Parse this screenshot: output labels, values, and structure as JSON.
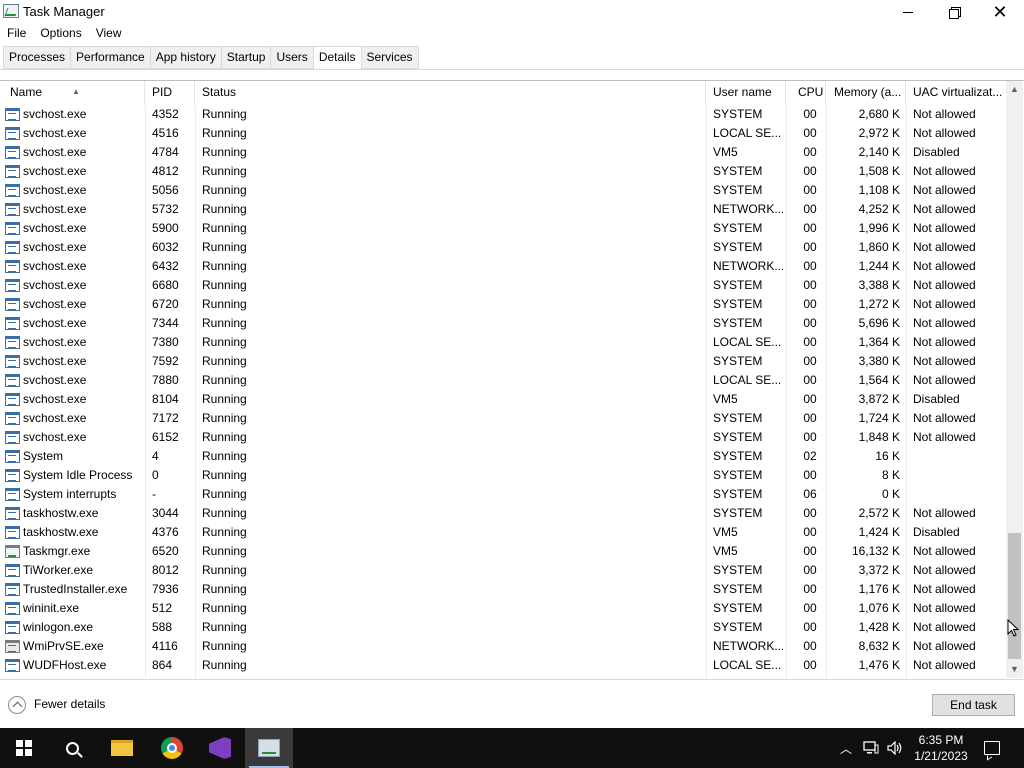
{
  "window": {
    "title": "Task Manager"
  },
  "menu": [
    "File",
    "Options",
    "View"
  ],
  "tabs": [
    "Processes",
    "Performance",
    "App history",
    "Startup",
    "Users",
    "Details",
    "Services"
  ],
  "active_tab": "Details",
  "columns": {
    "name": "Name",
    "pid": "PID",
    "status": "Status",
    "user": "User name",
    "cpu": "CPU",
    "memory": "Memory (a...",
    "uac": "UAC virtualizat..."
  },
  "rows": [
    {
      "name": "svchost.exe",
      "pid": "4352",
      "status": "Running",
      "user": "SYSTEM",
      "cpu": "00",
      "memory": "2,680 K",
      "uac": "Not allowed",
      "icon": "service-icon"
    },
    {
      "name": "svchost.exe",
      "pid": "4516",
      "status": "Running",
      "user": "LOCAL SE...",
      "cpu": "00",
      "memory": "2,972 K",
      "uac": "Not allowed",
      "icon": "service-icon"
    },
    {
      "name": "svchost.exe",
      "pid": "4784",
      "status": "Running",
      "user": "VM5",
      "cpu": "00",
      "memory": "2,140 K",
      "uac": "Disabled",
      "icon": "service-icon"
    },
    {
      "name": "svchost.exe",
      "pid": "4812",
      "status": "Running",
      "user": "SYSTEM",
      "cpu": "00",
      "memory": "1,508 K",
      "uac": "Not allowed",
      "icon": "service-icon"
    },
    {
      "name": "svchost.exe",
      "pid": "5056",
      "status": "Running",
      "user": "SYSTEM",
      "cpu": "00",
      "memory": "1,108 K",
      "uac": "Not allowed",
      "icon": "service-icon"
    },
    {
      "name": "svchost.exe",
      "pid": "5732",
      "status": "Running",
      "user": "NETWORK...",
      "cpu": "00",
      "memory": "4,252 K",
      "uac": "Not allowed",
      "icon": "service-icon"
    },
    {
      "name": "svchost.exe",
      "pid": "5900",
      "status": "Running",
      "user": "SYSTEM",
      "cpu": "00",
      "memory": "1,996 K",
      "uac": "Not allowed",
      "icon": "service-icon"
    },
    {
      "name": "svchost.exe",
      "pid": "6032",
      "status": "Running",
      "user": "SYSTEM",
      "cpu": "00",
      "memory": "1,860 K",
      "uac": "Not allowed",
      "icon": "service-icon"
    },
    {
      "name": "svchost.exe",
      "pid": "6432",
      "status": "Running",
      "user": "NETWORK...",
      "cpu": "00",
      "memory": "1,244 K",
      "uac": "Not allowed",
      "icon": "service-icon"
    },
    {
      "name": "svchost.exe",
      "pid": "6680",
      "status": "Running",
      "user": "SYSTEM",
      "cpu": "00",
      "memory": "3,388 K",
      "uac": "Not allowed",
      "icon": "service-icon"
    },
    {
      "name": "svchost.exe",
      "pid": "6720",
      "status": "Running",
      "user": "SYSTEM",
      "cpu": "00",
      "memory": "1,272 K",
      "uac": "Not allowed",
      "icon": "service-icon"
    },
    {
      "name": "svchost.exe",
      "pid": "7344",
      "status": "Running",
      "user": "SYSTEM",
      "cpu": "00",
      "memory": "5,696 K",
      "uac": "Not allowed",
      "icon": "service-icon"
    },
    {
      "name": "svchost.exe",
      "pid": "7380",
      "status": "Running",
      "user": "LOCAL SE...",
      "cpu": "00",
      "memory": "1,364 K",
      "uac": "Not allowed",
      "icon": "service-icon"
    },
    {
      "name": "svchost.exe",
      "pid": "7592",
      "status": "Running",
      "user": "SYSTEM",
      "cpu": "00",
      "memory": "3,380 K",
      "uac": "Not allowed",
      "icon": "service-icon"
    },
    {
      "name": "svchost.exe",
      "pid": "7880",
      "status": "Running",
      "user": "LOCAL SE...",
      "cpu": "00",
      "memory": "1,564 K",
      "uac": "Not allowed",
      "icon": "service-icon"
    },
    {
      "name": "svchost.exe",
      "pid": "8104",
      "status": "Running",
      "user": "VM5",
      "cpu": "00",
      "memory": "3,872 K",
      "uac": "Disabled",
      "icon": "service-icon"
    },
    {
      "name": "svchost.exe",
      "pid": "7172",
      "status": "Running",
      "user": "SYSTEM",
      "cpu": "00",
      "memory": "1,724 K",
      "uac": "Not allowed",
      "icon": "service-icon"
    },
    {
      "name": "svchost.exe",
      "pid": "6152",
      "status": "Running",
      "user": "SYSTEM",
      "cpu": "00",
      "memory": "1,848 K",
      "uac": "Not allowed",
      "icon": "service-icon"
    },
    {
      "name": "System",
      "pid": "4",
      "status": "Running",
      "user": "SYSTEM",
      "cpu": "02",
      "memory": "16 K",
      "uac": "",
      "icon": "service-icon"
    },
    {
      "name": "System Idle Process",
      "pid": "0",
      "status": "Running",
      "user": "SYSTEM",
      "cpu": "00",
      "memory": "8 K",
      "uac": "",
      "icon": "service-icon"
    },
    {
      "name": "System interrupts",
      "pid": "-",
      "status": "Running",
      "user": "SYSTEM",
      "cpu": "06",
      "memory": "0 K",
      "uac": "",
      "icon": "service-icon"
    },
    {
      "name": "taskhostw.exe",
      "pid": "3044",
      "status": "Running",
      "user": "SYSTEM",
      "cpu": "00",
      "memory": "2,572 K",
      "uac": "Not allowed",
      "icon": "service-icon"
    },
    {
      "name": "taskhostw.exe",
      "pid": "4376",
      "status": "Running",
      "user": "VM5",
      "cpu": "00",
      "memory": "1,424 K",
      "uac": "Disabled",
      "icon": "service-icon"
    },
    {
      "name": "Taskmgr.exe",
      "pid": "6520",
      "status": "Running",
      "user": "VM5",
      "cpu": "00",
      "memory": "16,132 K",
      "uac": "Not allowed",
      "icon": "task-manager-icon"
    },
    {
      "name": "TiWorker.exe",
      "pid": "8012",
      "status": "Running",
      "user": "SYSTEM",
      "cpu": "00",
      "memory": "3,372 K",
      "uac": "Not allowed",
      "icon": "service-icon"
    },
    {
      "name": "TrustedInstaller.exe",
      "pid": "7936",
      "status": "Running",
      "user": "SYSTEM",
      "cpu": "00",
      "memory": "1,176 K",
      "uac": "Not allowed",
      "icon": "service-icon"
    },
    {
      "name": "wininit.exe",
      "pid": "512",
      "status": "Running",
      "user": "SYSTEM",
      "cpu": "00",
      "memory": "1,076 K",
      "uac": "Not allowed",
      "icon": "service-icon"
    },
    {
      "name": "winlogon.exe",
      "pid": "588",
      "status": "Running",
      "user": "SYSTEM",
      "cpu": "00",
      "memory": "1,428 K",
      "uac": "Not allowed",
      "icon": "service-icon"
    },
    {
      "name": "WmiPrvSE.exe",
      "pid": "4116",
      "status": "Running",
      "user": "NETWORK...",
      "cpu": "00",
      "memory": "8,632 K",
      "uac": "Not allowed",
      "icon": "wmi-gear-icon"
    },
    {
      "name": "WUDFHost.exe",
      "pid": "864",
      "status": "Running",
      "user": "LOCAL SE...",
      "cpu": "00",
      "memory": "1,476 K",
      "uac": "Not allowed",
      "icon": "service-icon"
    }
  ],
  "footer": {
    "fewer_details": "Fewer details",
    "end_task": "End task"
  },
  "taskbar": {
    "time": "6:35 PM",
    "date": "1/21/2023",
    "apps": [
      "start-icon",
      "search-icon",
      "file-explorer-icon",
      "chrome-icon",
      "visual-studio-icon",
      "task-manager-icon"
    ]
  },
  "scrollbar": {
    "position_fraction": 1.0
  }
}
